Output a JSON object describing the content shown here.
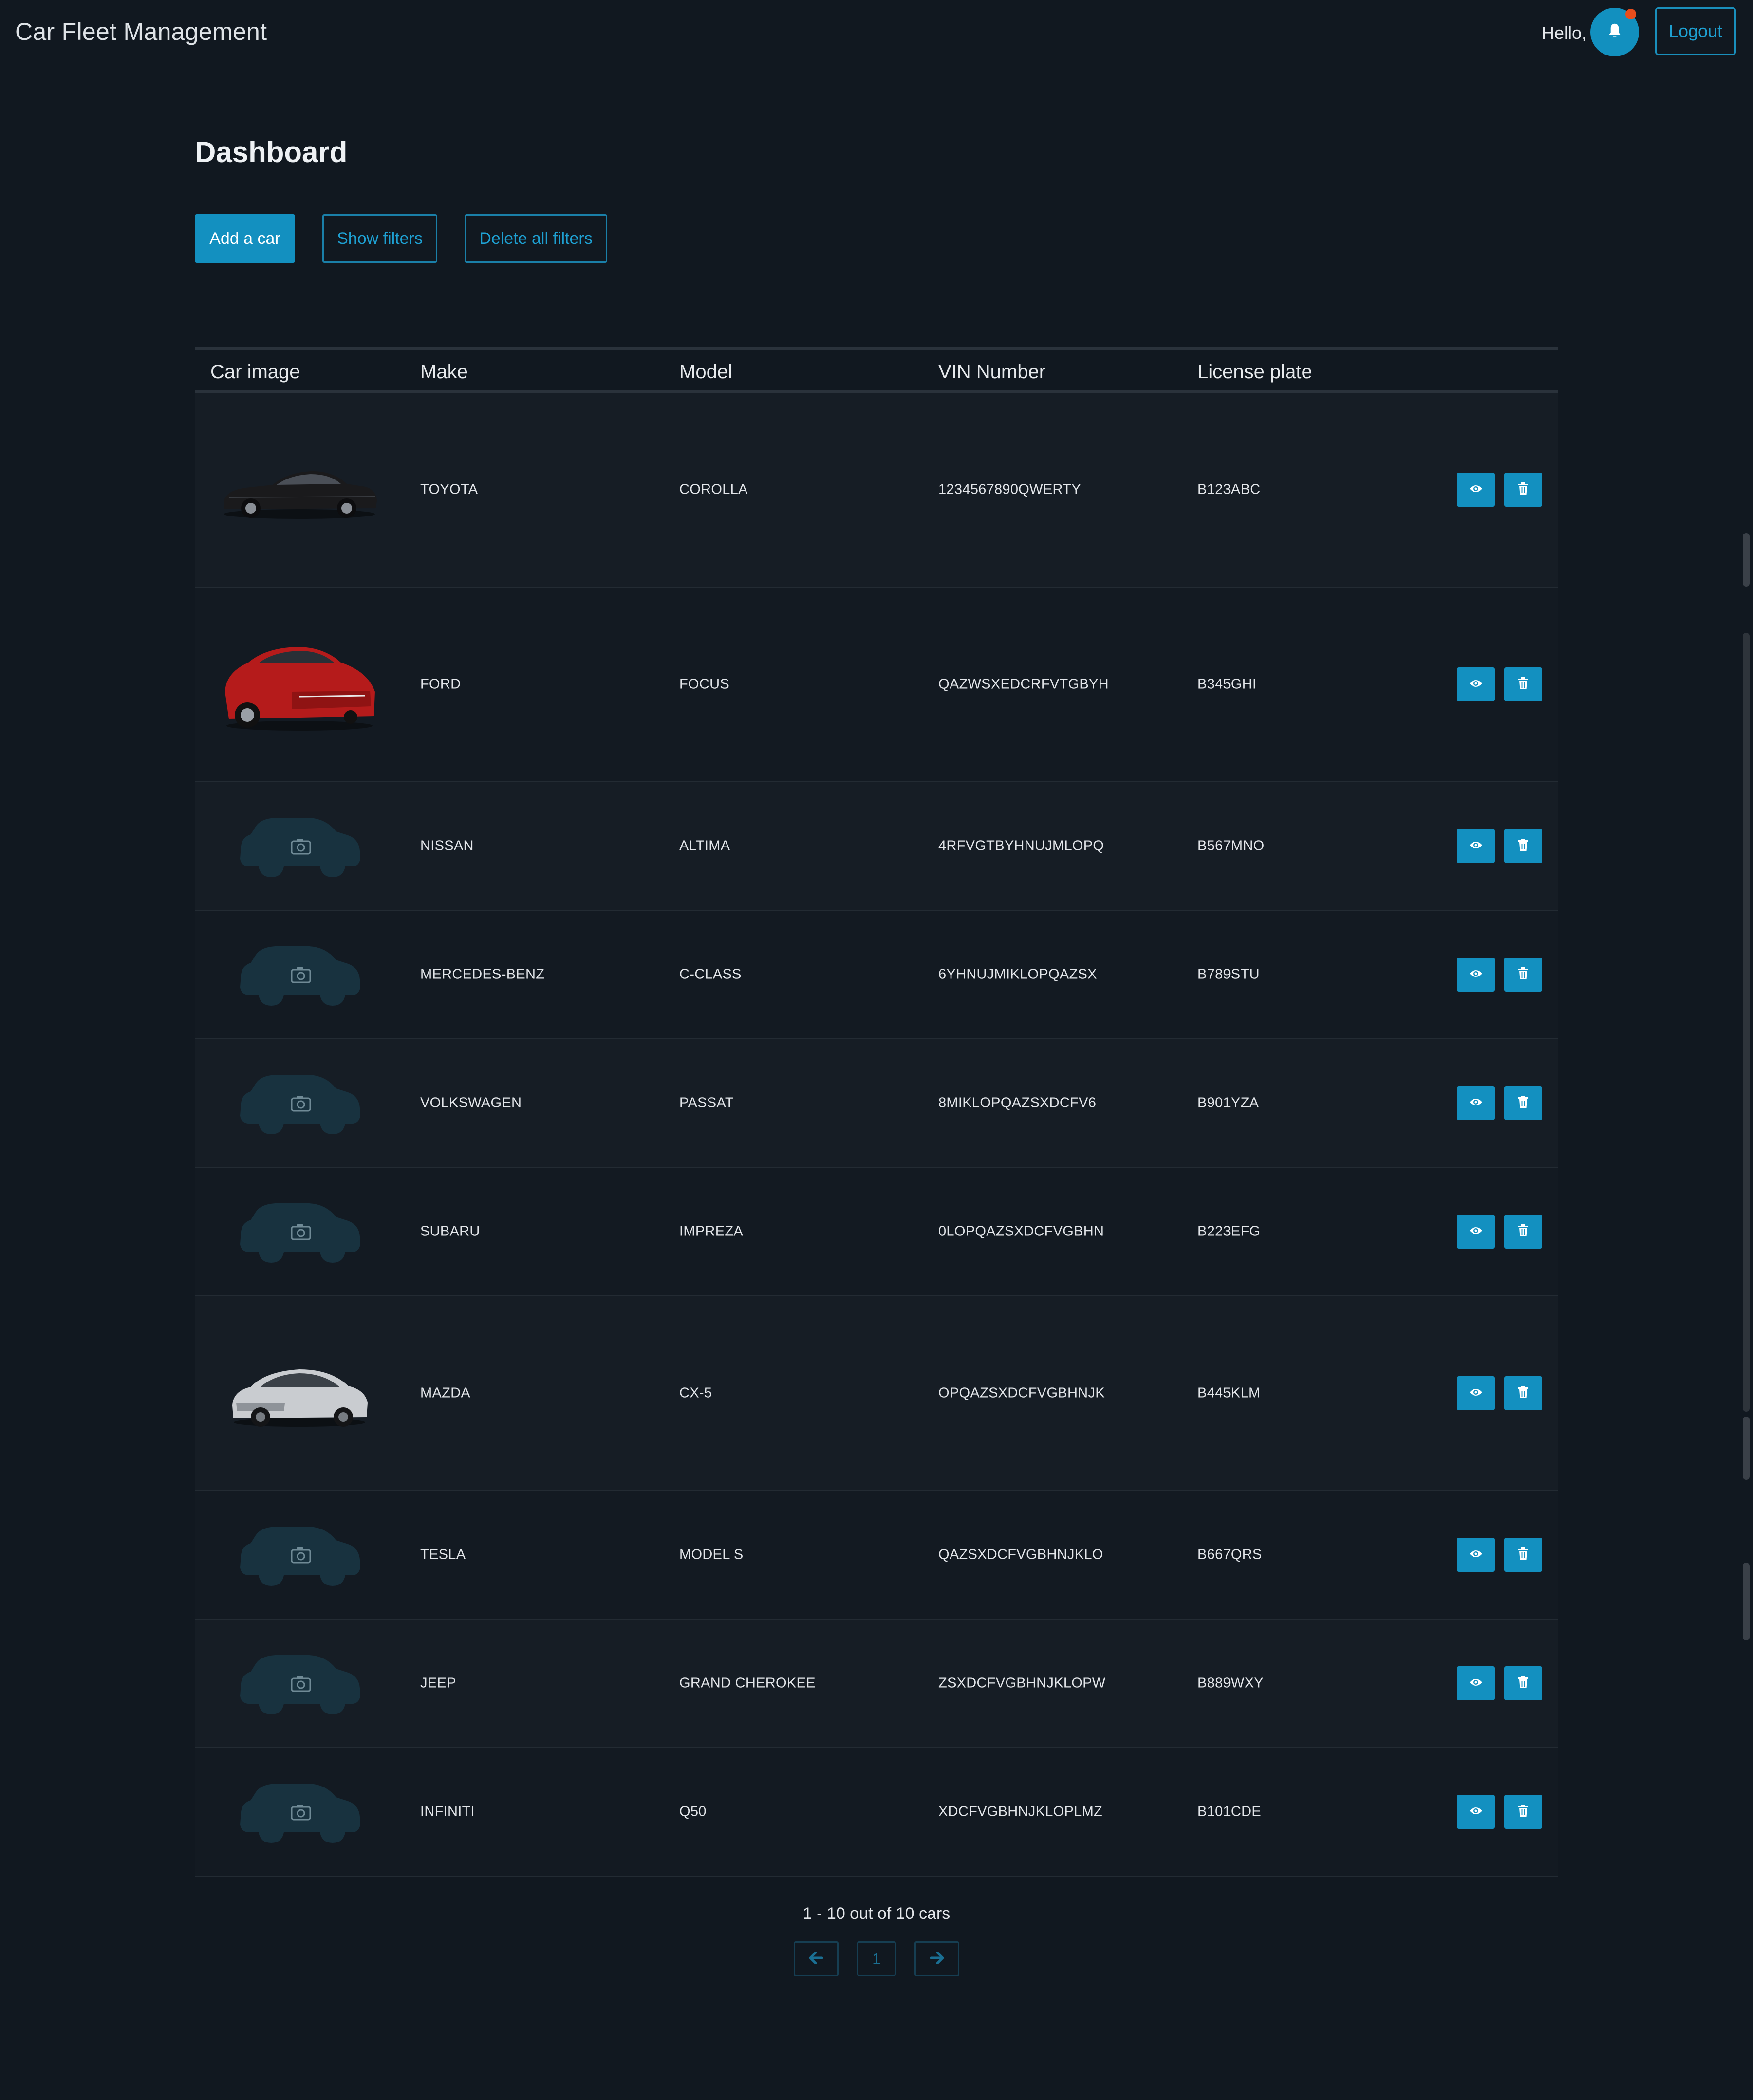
{
  "app": {
    "title": "Car Fleet Management",
    "greeting": "Hello, user",
    "logout_label": "Logout",
    "accent_color": "#1390c0",
    "notification_dot_color": "#e84d1c"
  },
  "page": {
    "title": "Dashboard"
  },
  "toolbar": {
    "add_label": "Add a car",
    "filters_label": "Show filters",
    "delete_filters_label": "Delete all filters"
  },
  "table": {
    "columns": [
      "Car image",
      "Make",
      "Model",
      "VIN Number",
      "License plate"
    ],
    "rows": [
      {
        "image": "black-sedan-photo",
        "make": "TOYOTA",
        "model": "COROLLA",
        "vin": "1234567890QWERTY",
        "plate": "B123ABC"
      },
      {
        "image": "red-hatchback-photo",
        "make": "FORD",
        "model": "FOCUS",
        "vin": "QAZWSXEDCRFVTGBYH",
        "plate": "B345GHI"
      },
      {
        "image": "placeholder-car-icon",
        "make": "NISSAN",
        "model": "ALTIMA",
        "vin": "4RFVGTBYHNUJMLOPQ",
        "plate": "B567MNO"
      },
      {
        "image": "placeholder-car-icon",
        "make": "MERCEDES-BENZ",
        "model": "C-CLASS",
        "vin": "6YHNUJMIKLOPQAZSX",
        "plate": "B789STU"
      },
      {
        "image": "placeholder-car-icon",
        "make": "VOLKSWAGEN",
        "model": "PASSAT",
        "vin": "8MIKLOPQAZSXDCFV6",
        "plate": "B901YZA"
      },
      {
        "image": "placeholder-car-icon",
        "make": "SUBARU",
        "model": "IMPREZA",
        "vin": "0LOPQAZSXDCFVGBHN",
        "plate": "B223EFG"
      },
      {
        "image": "silver-suv-photo",
        "make": "MAZDA",
        "model": "CX-5",
        "vin": "OPQAZSXDCFVGBHNJK",
        "plate": "B445KLM"
      },
      {
        "image": "placeholder-car-icon",
        "make": "TESLA",
        "model": "MODEL S",
        "vin": "QAZSXDCFVGBHNJKLO",
        "plate": "B667QRS"
      },
      {
        "image": "placeholder-car-icon",
        "make": "JEEP",
        "model": "GRAND CHEROKEE",
        "vin": "ZSXDCFVGBHNJKLOPW",
        "plate": "B889WXY"
      },
      {
        "image": "placeholder-car-icon",
        "make": "INFINITI",
        "model": "Q50",
        "vin": "XDCFVGBHNJKLOPLMZ",
        "plate": "B101CDE"
      }
    ],
    "actions": {
      "view_icon": "eye-icon",
      "delete_icon": "trash-icon"
    }
  },
  "pagination": {
    "summary": "1 - 10 out of 10 cars",
    "current_page": "1",
    "prev_icon": "arrow-left-icon",
    "next_icon": "arrow-right-icon"
  }
}
